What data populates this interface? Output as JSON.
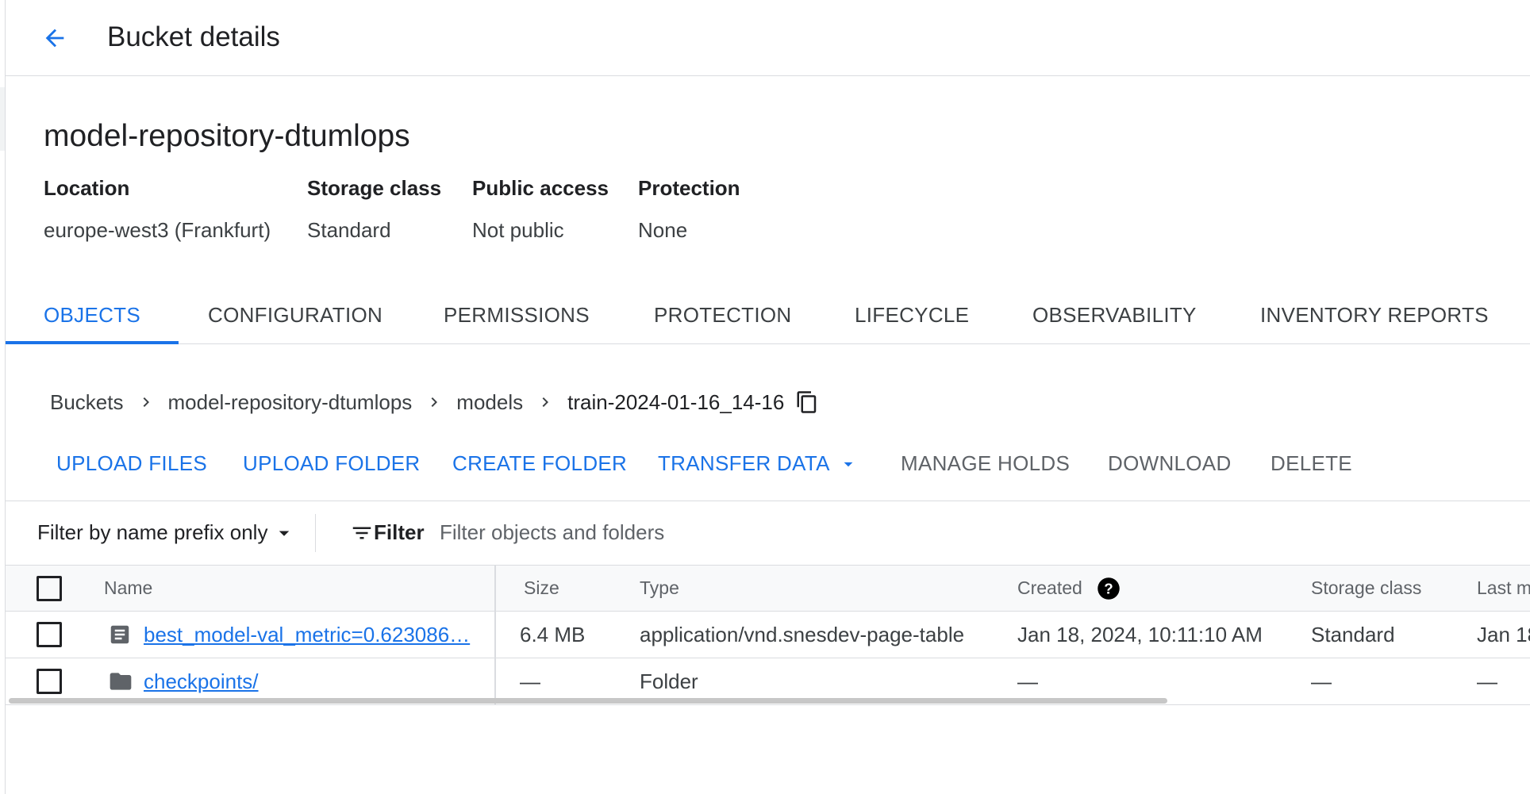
{
  "header": {
    "title": "Bucket details",
    "back_icon": "arrow-back-icon"
  },
  "bucket": {
    "name": "model-repository-dtumlops",
    "meta": [
      {
        "label": "Location",
        "value": "europe-west3 (Frankfurt)"
      },
      {
        "label": "Storage class",
        "value": "Standard"
      },
      {
        "label": "Public access",
        "value": "Not public"
      },
      {
        "label": "Protection",
        "value": "None"
      }
    ]
  },
  "tabs": [
    {
      "label": "OBJECTS",
      "active": true
    },
    {
      "label": "CONFIGURATION"
    },
    {
      "label": "PERMISSIONS"
    },
    {
      "label": "PROTECTION"
    },
    {
      "label": "LIFECYCLE"
    },
    {
      "label": "OBSERVABILITY"
    },
    {
      "label": "INVENTORY REPORTS"
    }
  ],
  "breadcrumb": [
    "Buckets",
    "model-repository-dtumlops",
    "models",
    "train-2024-01-16_14-16"
  ],
  "actions": {
    "upload_files": "UPLOAD FILES",
    "upload_folder": "UPLOAD FOLDER",
    "create_folder": "CREATE FOLDER",
    "transfer_data": "TRANSFER DATA",
    "manage_holds": "MANAGE HOLDS",
    "download": "DOWNLOAD",
    "delete": "DELETE"
  },
  "filter": {
    "mode": "Filter by name prefix only",
    "button": "Filter",
    "placeholder": "Filter objects and folders"
  },
  "table": {
    "columns": [
      "Name",
      "Size",
      "Type",
      "Created",
      "Storage class",
      "Last m"
    ],
    "rows": [
      {
        "icon": "file-icon",
        "name": "best_model-val_metric=0.623086…",
        "size": "6.4 MB",
        "type": "application/vnd.snesdev-page-table",
        "created": "Jan 18, 2024, 10:11:10 AM",
        "storage_class": "Standard",
        "last_modified": "Jan 18"
      },
      {
        "icon": "folder-icon",
        "name": "checkpoints/",
        "size": "—",
        "type": "Folder",
        "created": "—",
        "storage_class": "—",
        "last_modified": "—"
      }
    ]
  },
  "colors": {
    "accent": "#1a73e8",
    "text": "#202124",
    "muted": "#5f6368",
    "divider": "#dadce0"
  }
}
